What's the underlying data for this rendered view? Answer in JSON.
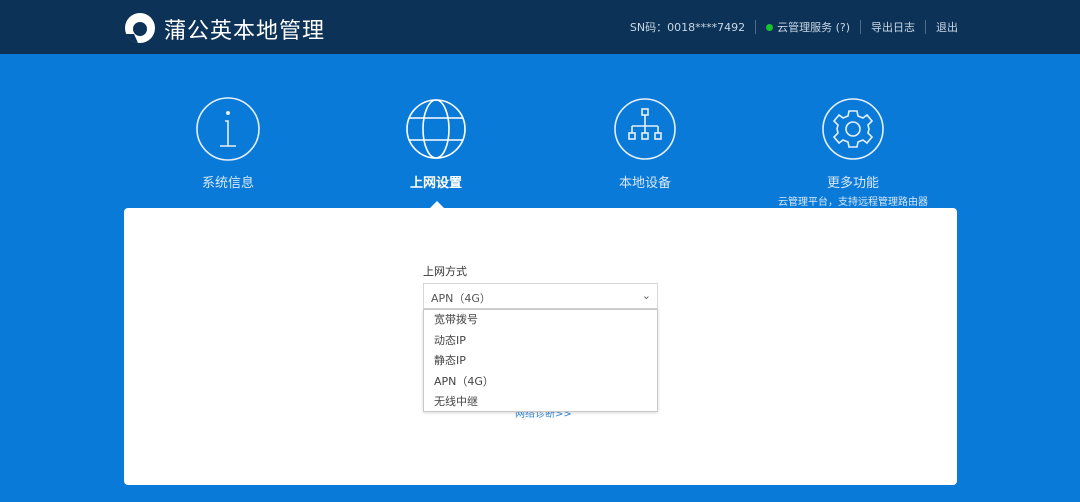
{
  "header": {
    "title": "蒲公英本地管理",
    "sn": "SN码：0018****7492",
    "cloud_service": "云管理服务 (?)",
    "cloud_status_color": "#19c42a",
    "export_log": "导出日志",
    "logout": "退出"
  },
  "nav": [
    {
      "label": "系统信息",
      "icon": "info-icon"
    },
    {
      "label": "上网设置",
      "icon": "globe-icon",
      "active": true
    },
    {
      "label": "本地设备",
      "icon": "network-tree-icon"
    },
    {
      "label": "更多功能",
      "icon": "gear-icon",
      "sub": "云管理平台，支持远程管理路由器"
    }
  ],
  "form": {
    "label": "上网方式",
    "selected": "APN（4G）",
    "options": [
      "宽带拨号",
      "动态IP",
      "静态IP",
      "APN（4G）",
      "无线中继"
    ],
    "link": "网络诊断>>"
  }
}
